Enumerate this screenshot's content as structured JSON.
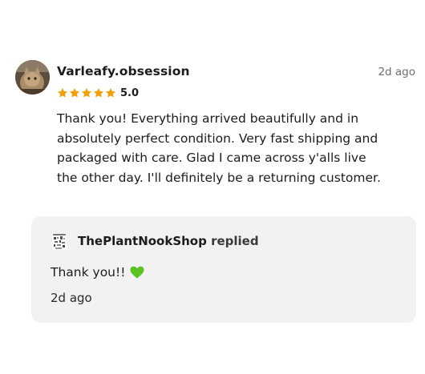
{
  "review": {
    "username": "Varleafy.obsession",
    "timestamp": "2d ago",
    "rating": {
      "value": "5.0",
      "stars": 5,
      "star_color": "#f2a007"
    },
    "text": "Thank you! Everything arrived beautifully and in absolutely perfect condition. Very fast shipping and packaged with care. Glad I came across y'alls live the other day. I'll definitely be a returning customer.",
    "avatar_icon": "cat-photo-avatar"
  },
  "reply": {
    "shop_name": "ThePlantNookShop",
    "replied_label": "replied",
    "text": "Thank you!!",
    "emoji": "green-heart-icon",
    "heart_color": "#58c322",
    "time": "2d ago",
    "background": "#f2f2f2",
    "shop_avatar_icon": "shop-logo-icon"
  }
}
